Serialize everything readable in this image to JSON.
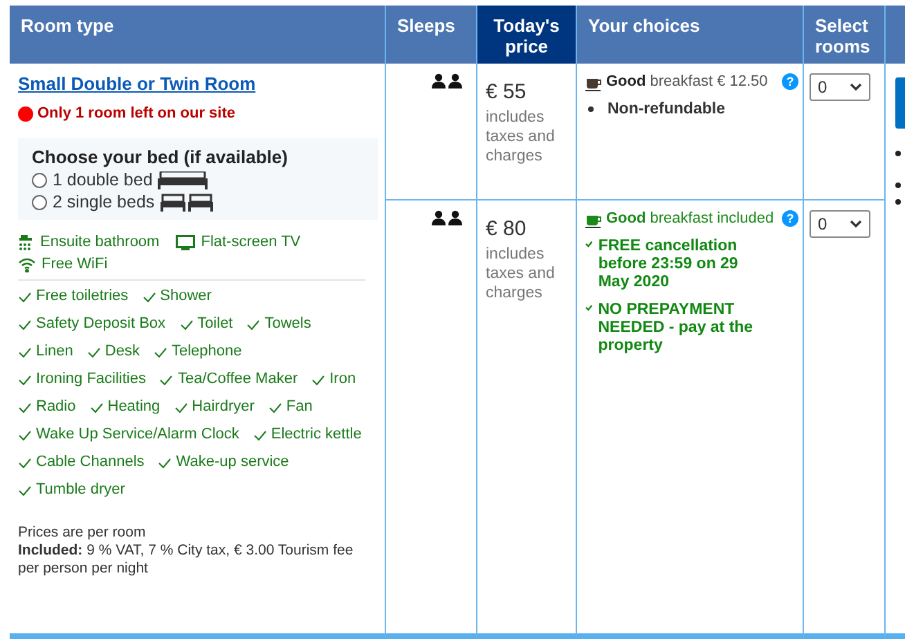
{
  "columns": [
    {
      "label": "Room type"
    },
    {
      "label": "Sleeps"
    },
    {
      "label": "Today's price"
    },
    {
      "label": "Your choices"
    },
    {
      "label": "Select rooms"
    }
  ],
  "room": {
    "name": "Small Double or Twin Room",
    "scarcity": {
      "text": "Only 1 room left on our site",
      "color": "#ff0000"
    },
    "bed_choice": {
      "title": "Choose your bed (if available)",
      "options": [
        {
          "label": "1 double bed",
          "kind": "double",
          "selected": false
        },
        {
          "label": "2 single beds",
          "kind": "single",
          "selected": false
        }
      ]
    },
    "highlights": [
      {
        "label": "Ensuite bathroom",
        "kind": "shower"
      },
      {
        "label": "Flat-screen TV",
        "kind": "tv"
      },
      {
        "label": "Free WiFi",
        "kind": "wifi"
      }
    ],
    "facilities": [
      "Free toiletries",
      "Shower",
      "Safety Deposit Box",
      "Toilet",
      "Towels",
      "Linen",
      "Desk",
      "Telephone",
      "Ironing Facilities",
      "Tea/Coffee Maker",
      "Iron",
      "Radio",
      "Heating",
      "Hairdryer",
      "Fan",
      "Wake Up Service/Alarm Clock",
      "Electric kettle",
      "Cable Channels",
      "Wake-up service",
      "Tumble dryer"
    ],
    "price_note": "Prices are per room",
    "included": "**Included:** 9 % VAT, 7 % City tax, € 3.00 Tourism fee per person per night"
  },
  "options": [
    {
      "price": "€ 55",
      "price_note": "includes taxes and charges",
      "breakfast": {
        "rating": "Good",
        "text": "breakfast € 12.50",
        "included": false,
        "help": "?"
      },
      "conditions": [
        {
          "kind": "bullet",
          "text": "Non-refundable"
        }
      ],
      "quantity": "0"
    },
    {
      "price": "€ 80",
      "price_note": "includes taxes and charges",
      "breakfast": {
        "rating": "Good",
        "text": "breakfast included",
        "included": true,
        "help": "?"
      },
      "conditions": [
        {
          "kind": "check",
          "text": "FREE cancellation before 23:59 on 29 May 2020"
        },
        {
          "kind": "check",
          "text": "NO PREPAYMENT NEEDED - pay at the property"
        }
      ],
      "quantity": "0"
    }
  ]
}
